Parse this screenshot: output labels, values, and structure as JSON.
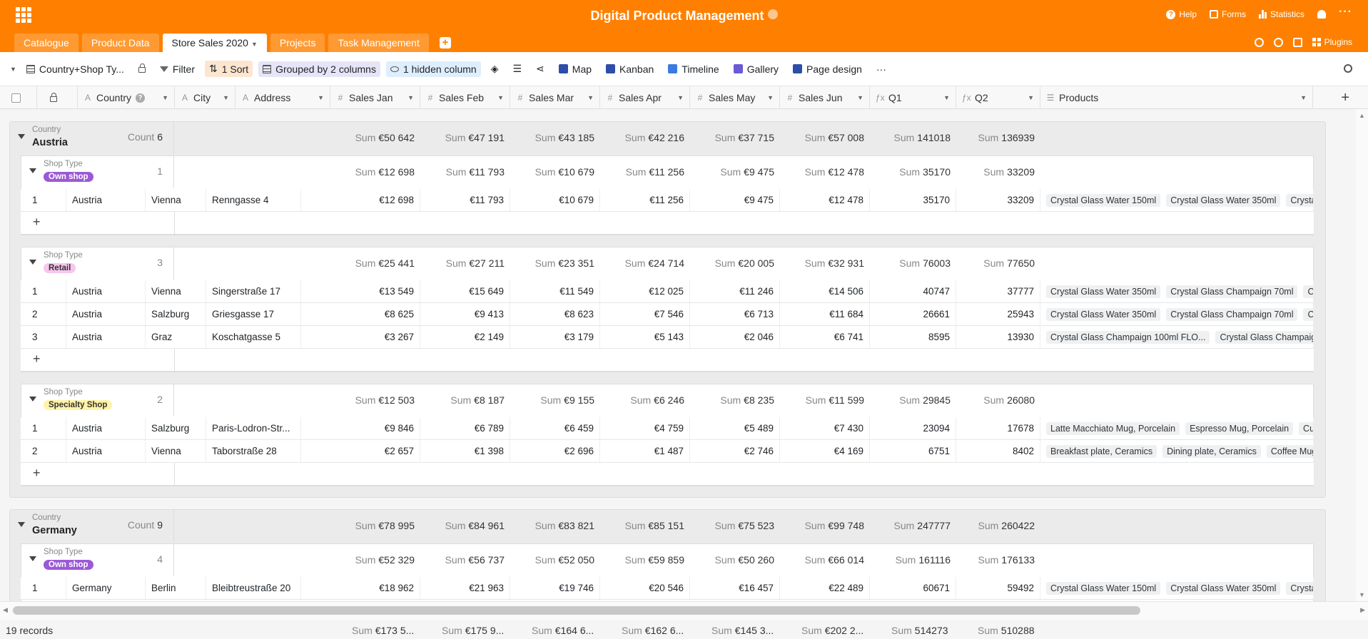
{
  "app": {
    "base_title": "Digital Product Management",
    "header_actions": [
      "Help",
      "Forms",
      "Statistics"
    ],
    "plugins_label": "Plugins",
    "tabs": [
      {
        "label": "Catalogue",
        "active": false
      },
      {
        "label": "Product Data",
        "active": false
      },
      {
        "label": "Store Sales 2020",
        "active": true
      },
      {
        "label": "Projects",
        "active": false
      },
      {
        "label": "Task Management",
        "active": false
      }
    ]
  },
  "toolbar": {
    "view_name": "Country+Shop Ty...",
    "filter": "Filter",
    "sort": "1 Sort",
    "group": "Grouped by 2 columns",
    "hidden": "1 hidden column",
    "map": "Map",
    "kanban": "Kanban",
    "timeline": "Timeline",
    "gallery": "Gallery",
    "page_design": "Page design"
  },
  "columns": [
    "Country",
    "City",
    "Address",
    "Sales Jan",
    "Sales Feb",
    "Sales Mar",
    "Sales Apr",
    "Sales May",
    "Sales Jun",
    "Q1",
    "Q2",
    "Products"
  ],
  "labels": {
    "country": "Country",
    "shop_type": "Shop Type",
    "count": "Count",
    "sum": "Sum"
  },
  "groups": [
    {
      "country": "Austria",
      "count": "6",
      "sums": [
        "€50 642",
        "€47 191",
        "€43 185",
        "€42 216",
        "€37 715",
        "€57 008",
        "141018",
        "136939"
      ],
      "subgroups": [
        {
          "shop_type": "Own shop",
          "badge_color": "#9b59d6",
          "badge_text": "#ffffff",
          "count": "1",
          "sums": [
            "€12 698",
            "€11 793",
            "€10 679",
            "€11 256",
            "€9 475",
            "€12 478",
            "35170",
            "33209"
          ],
          "rows": [
            {
              "n": "1",
              "country": "Austria",
              "city": "Vienna",
              "address": "Renngasse 4",
              "vals": [
                "€12 698",
                "€11 793",
                "€10 679",
                "€11 256",
                "€9 475",
                "€12 478",
                "35170",
                "33209"
              ],
              "products": [
                "Crystal Glass Water 150ml",
                "Crystal Glass Water 350ml",
                "Crystal Glass"
              ]
            }
          ]
        },
        {
          "shop_type": "Retail",
          "badge_color": "#f7c6ee",
          "badge_text": "#333333",
          "count": "3",
          "sums": [
            "€25 441",
            "€27 211",
            "€23 351",
            "€24 714",
            "€20 005",
            "€32 931",
            "76003",
            "77650"
          ],
          "rows": [
            {
              "n": "1",
              "country": "Austria",
              "city": "Vienna",
              "address": "Singerstraße 17",
              "vals": [
                "€13 549",
                "€15 649",
                "€11 549",
                "€12 025",
                "€11 246",
                "€14 506",
                "40747",
                "37777"
              ],
              "products": [
                "Crystal Glass Water 350ml",
                "Crystal Glass Champaign 70ml",
                "Crystal"
              ]
            },
            {
              "n": "2",
              "country": "Austria",
              "city": "Salzburg",
              "address": "Griesgasse 17",
              "vals": [
                "€8 625",
                "€9 413",
                "€8 623",
                "€7 546",
                "€6 713",
                "€11 684",
                "26661",
                "25943"
              ],
              "products": [
                "Crystal Glass Water 350ml",
                "Crystal Glass Champaign 70ml",
                "Crystal"
              ]
            },
            {
              "n": "3",
              "country": "Austria",
              "city": "Graz",
              "address": "Koschatgasse 5",
              "vals": [
                "€3 267",
                "€2 149",
                "€3 179",
                "€5 143",
                "€2 046",
                "€6 741",
                "8595",
                "13930"
              ],
              "products": [
                "Crystal Glass Champaign 100ml FLO...",
                "Crystal Glass Champaign"
              ]
            }
          ]
        },
        {
          "shop_type": "Specialty Shop",
          "badge_color": "#fff3a8",
          "badge_text": "#333333",
          "count": "2",
          "sums": [
            "€12 503",
            "€8 187",
            "€9 155",
            "€6 246",
            "€8 235",
            "€11 599",
            "29845",
            "26080"
          ],
          "rows": [
            {
              "n": "1",
              "country": "Austria",
              "city": "Salzburg",
              "address": "Paris-Lodron-Str...",
              "vals": [
                "€9 846",
                "€6 789",
                "€6 459",
                "€4 759",
                "€5 489",
                "€7 430",
                "23094",
                "17678"
              ],
              "products": [
                "Latte Macchiato Mug, Porcelain",
                "Espresso Mug, Porcelain",
                "Cup"
              ]
            },
            {
              "n": "2",
              "country": "Austria",
              "city": "Vienna",
              "address": "Taborstraße 28",
              "vals": [
                "€2 657",
                "€1 398",
                "€2 696",
                "€1 487",
                "€2 746",
                "€4 169",
                "6751",
                "8402"
              ],
              "products": [
                "Breakfast plate, Ceramics",
                "Dining plate, Ceramics",
                "Coffee Mug"
              ]
            }
          ]
        }
      ]
    },
    {
      "country": "Germany",
      "count": "9",
      "sums": [
        "€78 995",
        "€84 961",
        "€83 821",
        "€85 151",
        "€75 523",
        "€99 748",
        "247777",
        "260422"
      ],
      "subgroups": [
        {
          "shop_type": "Own shop",
          "badge_color": "#9b59d6",
          "badge_text": "#ffffff",
          "count": "4",
          "sums": [
            "€52 329",
            "€56 737",
            "€52 050",
            "€59 859",
            "€50 260",
            "€66 014",
            "161116",
            "176133"
          ],
          "rows": [
            {
              "n": "1",
              "country": "Germany",
              "city": "Berlin",
              "address": "Bleibtreustraße 20",
              "vals": [
                "€18 962",
                "€21 963",
                "€19 746",
                "€20 546",
                "€16 457",
                "€22 489",
                "60671",
                "59492"
              ],
              "products": [
                "Crystal Glass Water 150ml",
                "Crystal Glass Water 350ml",
                "Crystal Glass"
              ]
            }
          ]
        }
      ]
    }
  ],
  "footer": {
    "records": "19 records",
    "sums": [
      "€173 5...",
      "€175 9...",
      "€164 6...",
      "€162 6...",
      "€145 3...",
      "€202 2...",
      "514273",
      "510288"
    ]
  }
}
